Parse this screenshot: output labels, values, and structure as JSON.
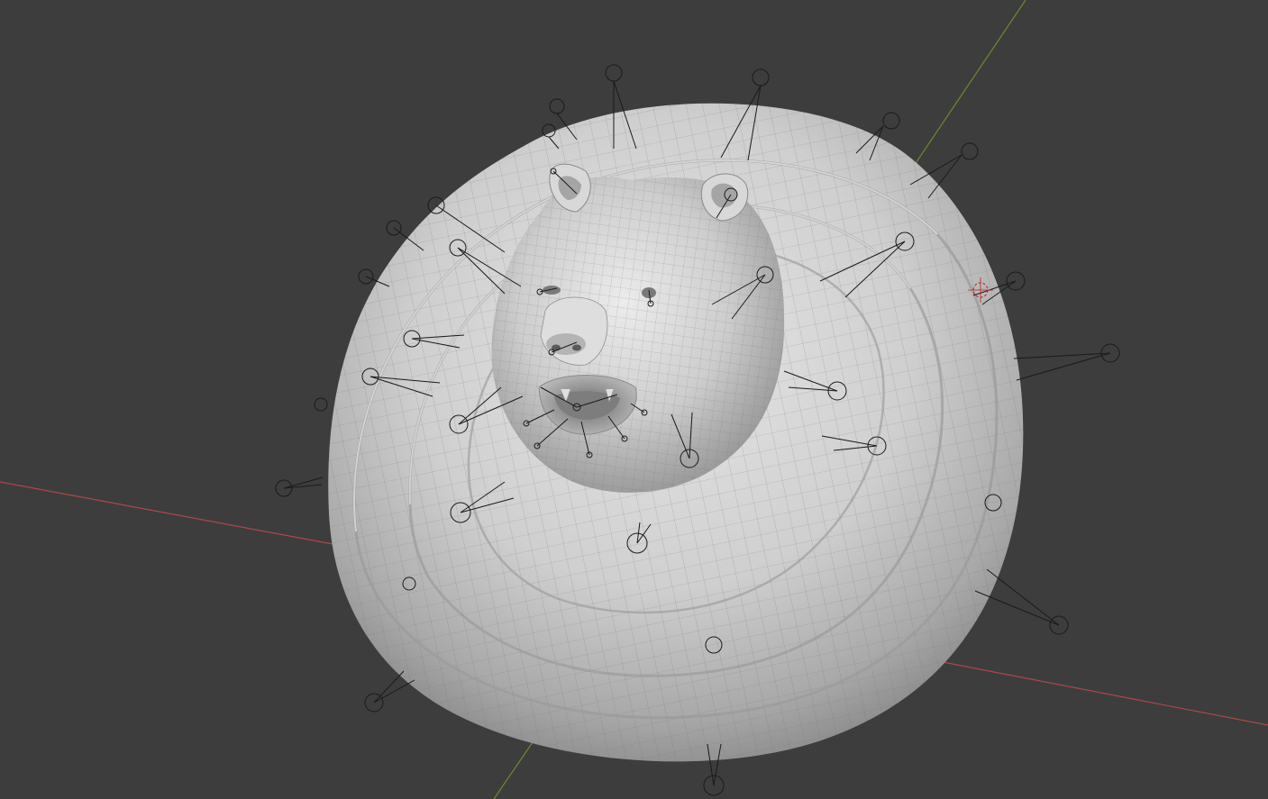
{
  "viewport": {
    "background_color": "#3d3d3d",
    "x_axis_color": "#b0474a",
    "y_axis_color": "#6b8a2f",
    "mesh_color": "#c9c9c9",
    "wire_color": "#6e6e6e",
    "bone_color": "#1a1a1a",
    "cursor_color": "#c02020"
  },
  "scene": {
    "object": "bear-head-relief",
    "icons": [
      "3d-cursor-icon",
      "empty-control-circle-icon",
      "bone-line-icon"
    ]
  }
}
